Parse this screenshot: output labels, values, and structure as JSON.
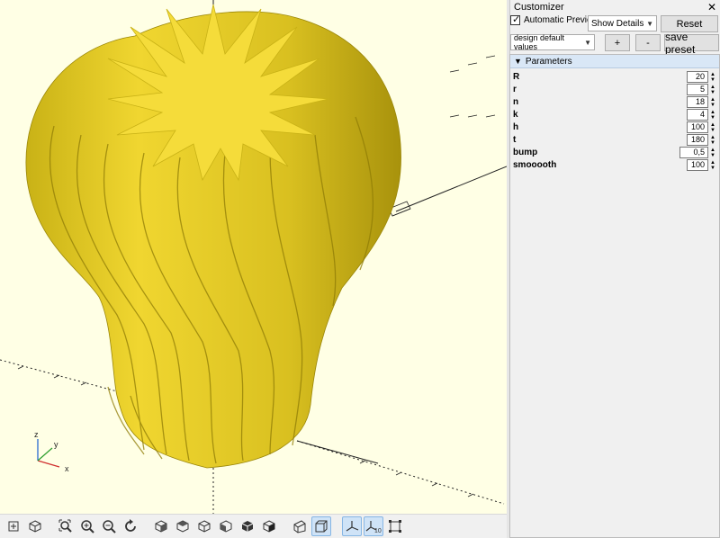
{
  "viewport": {
    "axes_labels": {
      "x": "x",
      "y": "y",
      "z": "z"
    }
  },
  "toolbar": {
    "buttons": [
      {
        "icon": "view-all-icon"
      },
      {
        "icon": "reset-view-icon"
      },
      {
        "icon": "zoom-in-icon"
      },
      {
        "icon": "zoom-out-icon"
      },
      {
        "icon": "rotate-reset-icon"
      },
      {
        "icon": "view-right-icon"
      },
      {
        "icon": "view-top-icon"
      },
      {
        "icon": "view-bottom-icon"
      },
      {
        "icon": "view-left-icon"
      },
      {
        "icon": "view-front-icon"
      },
      {
        "icon": "view-back-icon"
      },
      {
        "icon": "perspective-icon"
      },
      {
        "icon": "orthogonal-icon"
      },
      {
        "icon": "show-axes-icon"
      },
      {
        "icon": "show-scale-markers-icon"
      },
      {
        "icon": "show-edges-icon"
      }
    ],
    "scale_marker_label": "10"
  },
  "customizer": {
    "title": "Customizer",
    "close": "✕",
    "automatic_preview_label": "Automatic Preview",
    "automatic_preview_checked": true,
    "details_select": "Show Details",
    "reset_label": "Reset",
    "preset_select": "design default values",
    "add_label": "+",
    "remove_label": "-",
    "save_preset_label": "save preset",
    "section_title": "Parameters",
    "params": [
      {
        "name": "R",
        "value": "20"
      },
      {
        "name": "r",
        "value": "5"
      },
      {
        "name": "n",
        "value": "18"
      },
      {
        "name": "k",
        "value": "4"
      },
      {
        "name": "h",
        "value": "100"
      },
      {
        "name": "t",
        "value": "180"
      },
      {
        "name": "bump",
        "value": "0,5"
      },
      {
        "name": "smooooth",
        "value": "100"
      }
    ]
  },
  "colors": {
    "model": "#e8cf2a",
    "model_light": "#f5dc3a",
    "model_shadow": "#b8a10e",
    "viewport_bg": "#ffffe5",
    "header_bg": "#d9e7f6"
  }
}
